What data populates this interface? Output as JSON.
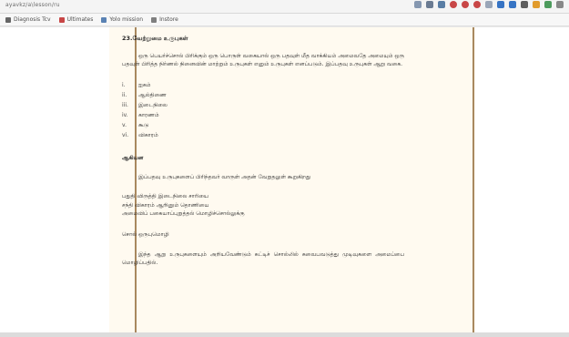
{
  "browser": {
    "url_text": "ayavkz/a\\lesson/ru",
    "toolbar_icons": [
      "bookmark-icon",
      "sync-icon",
      "grid-icon",
      "red-circle-icon",
      "red-circle-icon",
      "red-circle-icon",
      "extension-icon",
      "blue-icon",
      "blue-icon",
      "dark-square-icon",
      "orange-icon",
      "profile-icon",
      "translate-icon"
    ],
    "icon_colors": {
      "bookmark": "#7d8ea7",
      "sync": "#6b7b92",
      "grid": "#597da4",
      "red": "#c84646",
      "dark": "#5d5d5d",
      "blue": "#3774c4",
      "orange": "#e19b2c",
      "green": "#4d9b5d"
    }
  },
  "bookmarks": [
    {
      "label": "Diagnosis Tcv",
      "icon_color": "#666666"
    },
    {
      "label": "Ultimates",
      "icon_color": "#c84646"
    },
    {
      "label": "Yolo mission",
      "icon_color": "#5a82b4"
    },
    {
      "label": "Instore",
      "icon_color": "#7f7f7f"
    }
  ],
  "document": {
    "heading": "23.வேற்றுமை உருபுகள்",
    "paragraph1": "ஒரு பெயர்ச்சொல் பிரிக்கும் ஒரு பொருள் வகையால் ஒரு பதவுள் மீத வாக்கியம் அமைவதே அமையும் ஒரு பதவுள் பிரித்த நிர்ணல் நினைவின் மாற்றும் உருபுகள் எனும் உருபுகள் எனப்படும். இப்பதவு உருபுகள் ஆறு வகை.",
    "list": [
      {
        "num": "i.",
        "text": "ஐகம்"
      },
      {
        "num": "ii.",
        "text": "ஆல்திணை"
      },
      {
        "num": "iii.",
        "text": "இடைநிலை"
      },
      {
        "num": "iv.",
        "text": "காரணம்"
      },
      {
        "num": "v.",
        "text": "கூடு"
      },
      {
        "num": "vi.",
        "text": "விகாரம்"
      }
    ],
    "example_label": "ஆகியன",
    "paragraph2": "இப்பதவு உருபுகளைப் பிரிந்தவர் வாருள் அதன் வேறுதலுள் கூறுகிறது",
    "verse": [
      "பதுதி விருத்தி இடைநிலை சாரியை",
      "சந்தி விகாரம் ஆறினும் தொணியை",
      "அமைவிப் பகையாப்புறுத்தல் மொழிச்சொல்லுக்கு"
    ],
    "word_note": "சொல் ஒருபுமொழி",
    "paragraph3": "இந்த ஆறு உருபுகளையும் அறியவேண்டும் கட்டிச் சொல்லில் சுவைபவடுத்து முடிவுகளை அமைப்பை மொழிப்பதில்."
  }
}
